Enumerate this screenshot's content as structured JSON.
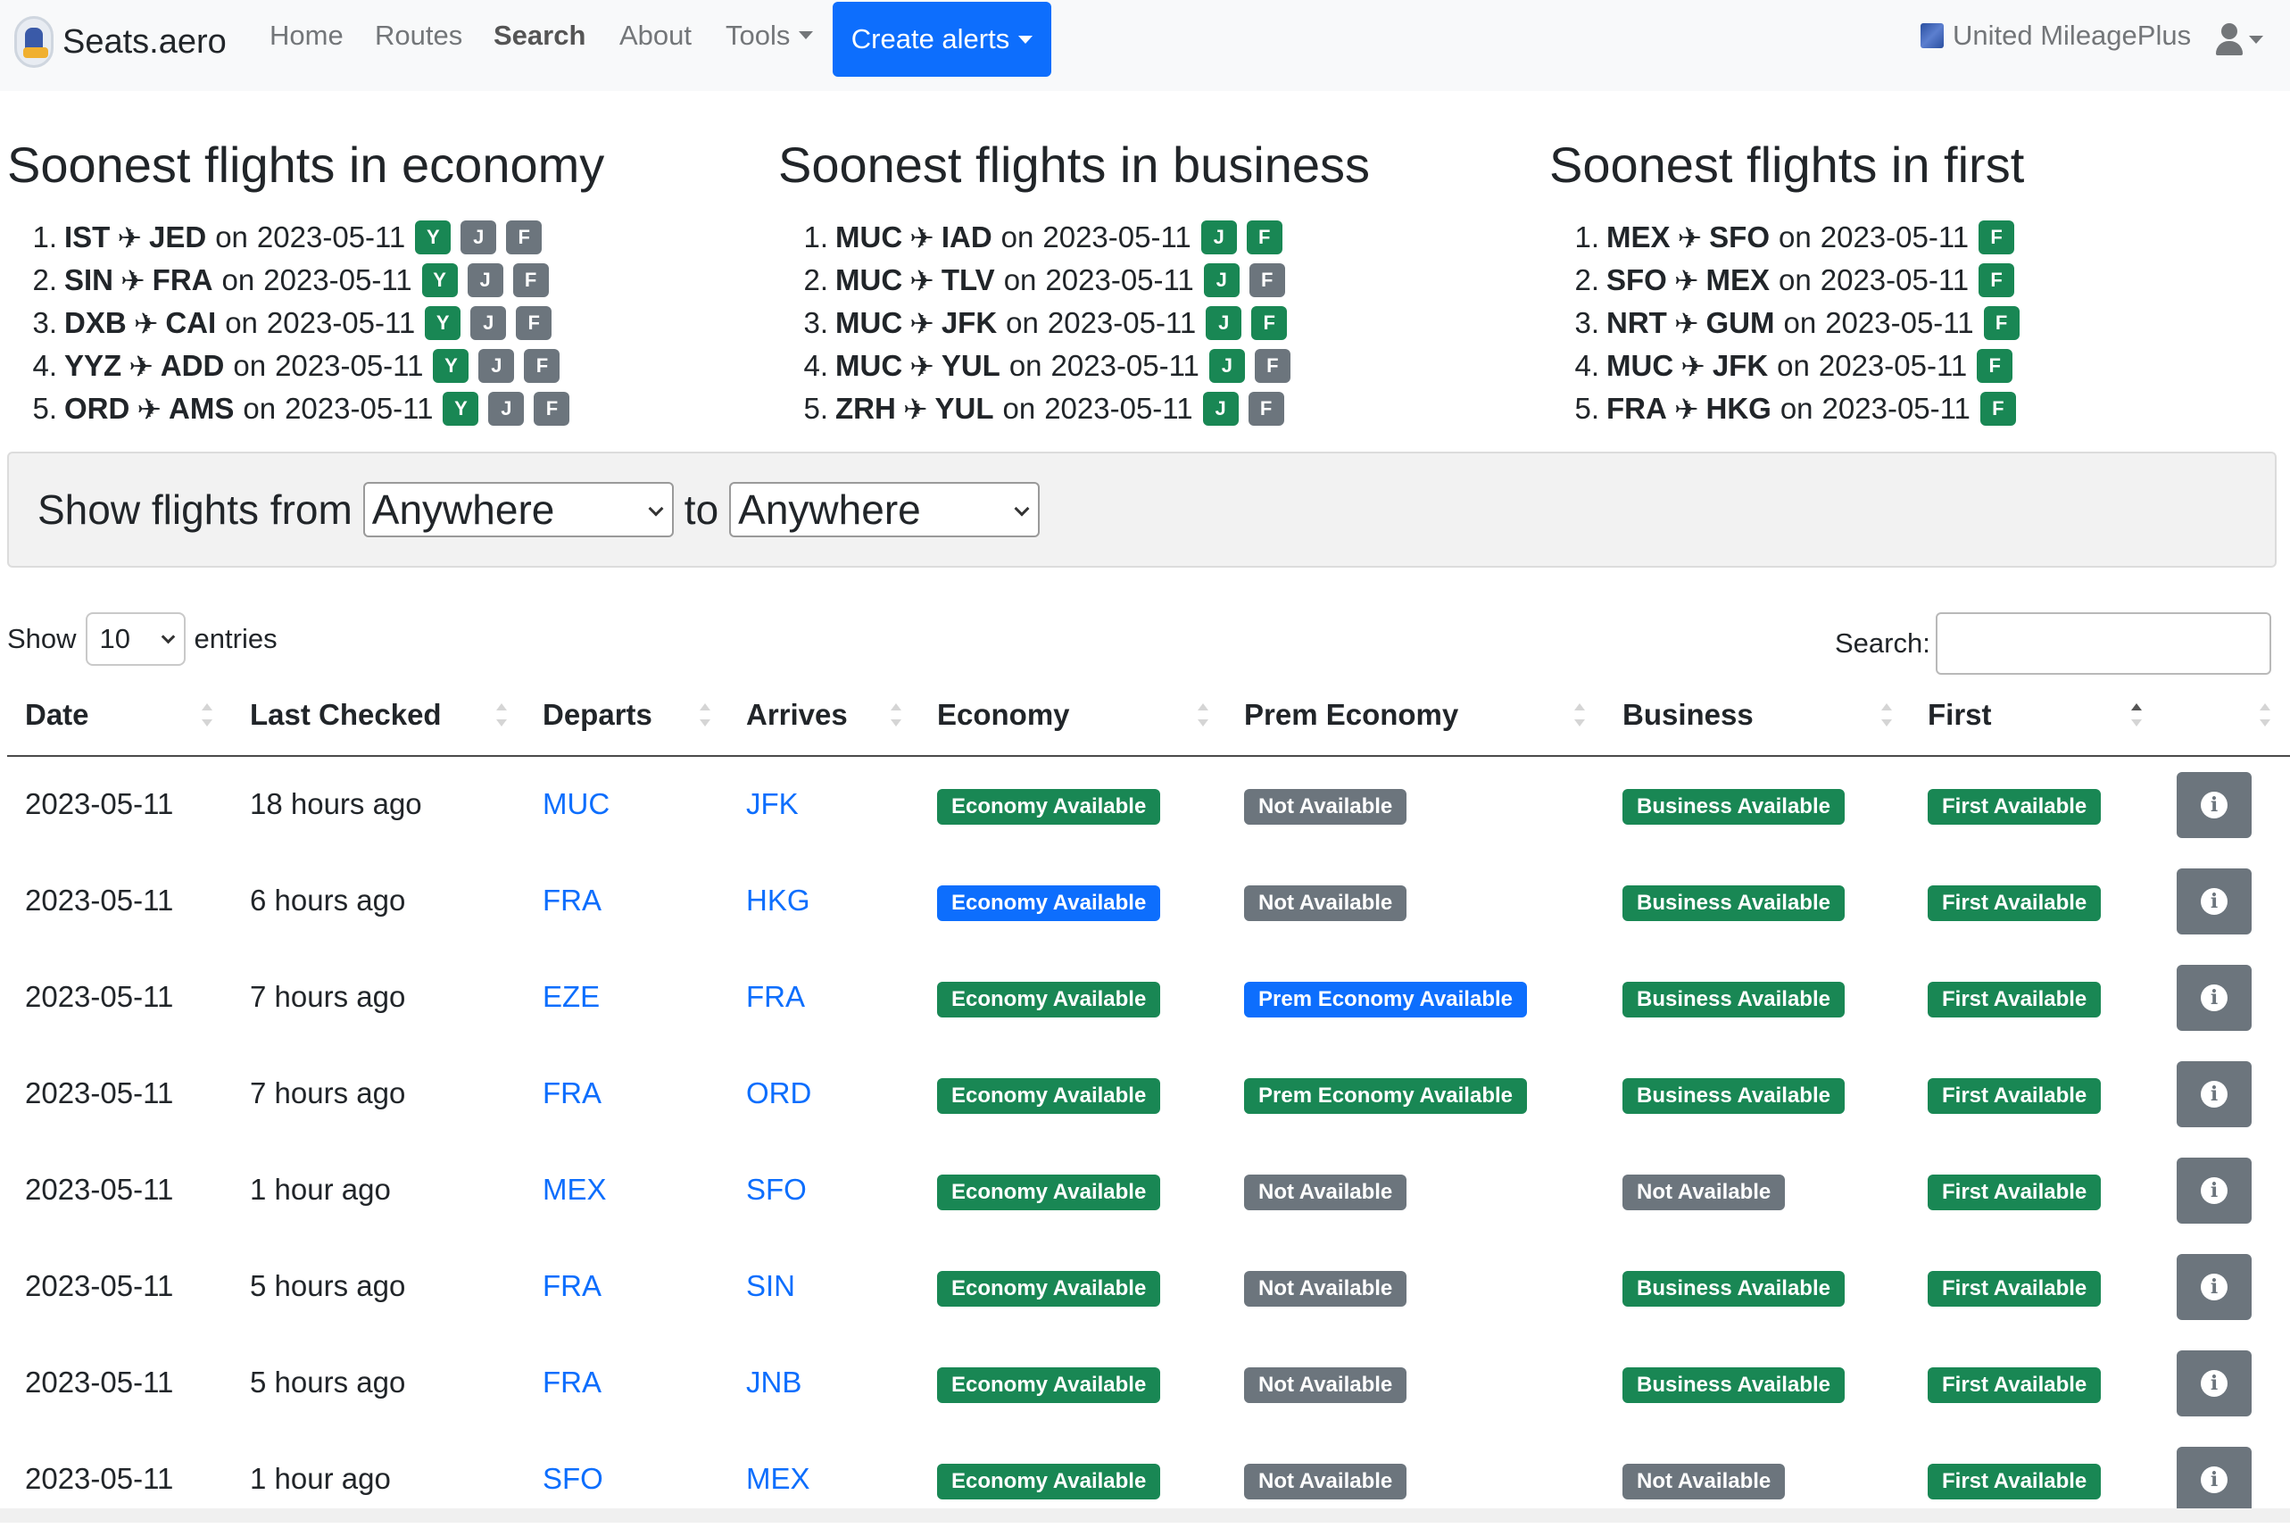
{
  "navbar": {
    "brand": "Seats.aero",
    "links": [
      "Home",
      "Routes",
      "Search",
      "About",
      "Tools"
    ],
    "create_alerts": "Create alerts",
    "program": "United MileagePlus"
  },
  "soonest": [
    {
      "title": "Soonest flights in economy",
      "items": [
        {
          "num": "1.",
          "from": "IST",
          "to": "JED",
          "on": "on",
          "date": "2023-05-11",
          "classes": [
            {
              "c": "Y",
              "s": "g"
            },
            {
              "c": "J",
              "s": "s"
            },
            {
              "c": "F",
              "s": "s"
            }
          ]
        },
        {
          "num": "2.",
          "from": "SIN",
          "to": "FRA",
          "on": "on",
          "date": "2023-05-11",
          "classes": [
            {
              "c": "Y",
              "s": "g"
            },
            {
              "c": "J",
              "s": "s"
            },
            {
              "c": "F",
              "s": "s"
            }
          ]
        },
        {
          "num": "3.",
          "from": "DXB",
          "to": "CAI",
          "on": "on",
          "date": "2023-05-11",
          "classes": [
            {
              "c": "Y",
              "s": "g"
            },
            {
              "c": "J",
              "s": "s"
            },
            {
              "c": "F",
              "s": "s"
            }
          ]
        },
        {
          "num": "4.",
          "from": "YYZ",
          "to": "ADD",
          "on": "on",
          "date": "2023-05-11",
          "classes": [
            {
              "c": "Y",
              "s": "g"
            },
            {
              "c": "J",
              "s": "s"
            },
            {
              "c": "F",
              "s": "s"
            }
          ]
        },
        {
          "num": "5.",
          "from": "ORD",
          "to": "AMS",
          "on": "on",
          "date": "2023-05-11",
          "classes": [
            {
              "c": "Y",
              "s": "g"
            },
            {
              "c": "J",
              "s": "s"
            },
            {
              "c": "F",
              "s": "s"
            }
          ]
        }
      ]
    },
    {
      "title": "Soonest flights in business",
      "items": [
        {
          "num": "1.",
          "from": "MUC",
          "to": "IAD",
          "on": "on",
          "date": "2023-05-11",
          "classes": [
            {
              "c": "J",
              "s": "g"
            },
            {
              "c": "F",
              "s": "g"
            }
          ]
        },
        {
          "num": "2.",
          "from": "MUC",
          "to": "TLV",
          "on": "on",
          "date": "2023-05-11",
          "classes": [
            {
              "c": "J",
              "s": "g"
            },
            {
              "c": "F",
              "s": "s"
            }
          ]
        },
        {
          "num": "3.",
          "from": "MUC",
          "to": "JFK",
          "on": "on",
          "date": "2023-05-11",
          "classes": [
            {
              "c": "J",
              "s": "g"
            },
            {
              "c": "F",
              "s": "g"
            }
          ]
        },
        {
          "num": "4.",
          "from": "MUC",
          "to": "YUL",
          "on": "on",
          "date": "2023-05-11",
          "classes": [
            {
              "c": "J",
              "s": "g"
            },
            {
              "c": "F",
              "s": "s"
            }
          ]
        },
        {
          "num": "5.",
          "from": "ZRH",
          "to": "YUL",
          "on": "on",
          "date": "2023-05-11",
          "classes": [
            {
              "c": "J",
              "s": "g"
            },
            {
              "c": "F",
              "s": "s"
            }
          ]
        }
      ]
    },
    {
      "title": "Soonest flights in first",
      "items": [
        {
          "num": "1.",
          "from": "MEX",
          "to": "SFO",
          "on": "on",
          "date": "2023-05-11",
          "classes": [
            {
              "c": "F",
              "s": "g"
            }
          ]
        },
        {
          "num": "2.",
          "from": "SFO",
          "to": "MEX",
          "on": "on",
          "date": "2023-05-11",
          "classes": [
            {
              "c": "F",
              "s": "g"
            }
          ]
        },
        {
          "num": "3.",
          "from": "NRT",
          "to": "GUM",
          "on": "on",
          "date": "2023-05-11",
          "classes": [
            {
              "c": "F",
              "s": "g"
            }
          ]
        },
        {
          "num": "4.",
          "from": "MUC",
          "to": "JFK",
          "on": "on",
          "date": "2023-05-11",
          "classes": [
            {
              "c": "F",
              "s": "g"
            }
          ]
        },
        {
          "num": "5.",
          "from": "FRA",
          "to": "HKG",
          "on": "on",
          "date": "2023-05-11",
          "classes": [
            {
              "c": "F",
              "s": "g"
            }
          ]
        }
      ]
    }
  ],
  "filter": {
    "label_from": "Show flights from",
    "from_value": "Anywhere",
    "label_to": "to",
    "to_value": "Anywhere"
  },
  "table_controls": {
    "show": "Show",
    "entries_value": "10",
    "entries": "entries",
    "search_label": "Search:"
  },
  "table": {
    "headers": [
      "Date",
      "Last Checked",
      "Departs",
      "Arrives",
      "Economy",
      "Prem Economy",
      "Business",
      "First"
    ],
    "rows": [
      {
        "date": "2023-05-11",
        "checked": "18 hours ago",
        "departs": "MUC",
        "arrives": "JFK",
        "economy": {
          "t": "Economy Available",
          "s": "green"
        },
        "prem": {
          "t": "Not Available",
          "s": "gray"
        },
        "business": {
          "t": "Business Available",
          "s": "green"
        },
        "first": {
          "t": "First Available",
          "s": "green"
        }
      },
      {
        "date": "2023-05-11",
        "checked": "6 hours ago",
        "departs": "FRA",
        "arrives": "HKG",
        "economy": {
          "t": "Economy Available",
          "s": "blue"
        },
        "prem": {
          "t": "Not Available",
          "s": "gray"
        },
        "business": {
          "t": "Business Available",
          "s": "green"
        },
        "first": {
          "t": "First Available",
          "s": "green"
        }
      },
      {
        "date": "2023-05-11",
        "checked": "7 hours ago",
        "departs": "EZE",
        "arrives": "FRA",
        "economy": {
          "t": "Economy Available",
          "s": "green"
        },
        "prem": {
          "t": "Prem Economy Available",
          "s": "blue"
        },
        "business": {
          "t": "Business Available",
          "s": "green"
        },
        "first": {
          "t": "First Available",
          "s": "green"
        }
      },
      {
        "date": "2023-05-11",
        "checked": "7 hours ago",
        "departs": "FRA",
        "arrives": "ORD",
        "economy": {
          "t": "Economy Available",
          "s": "green"
        },
        "prem": {
          "t": "Prem Economy Available",
          "s": "green"
        },
        "business": {
          "t": "Business Available",
          "s": "green"
        },
        "first": {
          "t": "First Available",
          "s": "green"
        }
      },
      {
        "date": "2023-05-11",
        "checked": "1 hour ago",
        "departs": "MEX",
        "arrives": "SFO",
        "economy": {
          "t": "Economy Available",
          "s": "green"
        },
        "prem": {
          "t": "Not Available",
          "s": "gray"
        },
        "business": {
          "t": "Not Available",
          "s": "gray"
        },
        "first": {
          "t": "First Available",
          "s": "green"
        }
      },
      {
        "date": "2023-05-11",
        "checked": "5 hours ago",
        "departs": "FRA",
        "arrives": "SIN",
        "economy": {
          "t": "Economy Available",
          "s": "green"
        },
        "prem": {
          "t": "Not Available",
          "s": "gray"
        },
        "business": {
          "t": "Business Available",
          "s": "green"
        },
        "first": {
          "t": "First Available",
          "s": "green"
        }
      },
      {
        "date": "2023-05-11",
        "checked": "5 hours ago",
        "departs": "FRA",
        "arrives": "JNB",
        "economy": {
          "t": "Economy Available",
          "s": "green"
        },
        "prem": {
          "t": "Not Available",
          "s": "gray"
        },
        "business": {
          "t": "Business Available",
          "s": "green"
        },
        "first": {
          "t": "First Available",
          "s": "green"
        }
      },
      {
        "date": "2023-05-11",
        "checked": "1 hour ago",
        "departs": "SFO",
        "arrives": "MEX",
        "economy": {
          "t": "Economy Available",
          "s": "green"
        },
        "prem": {
          "t": "Not Available",
          "s": "gray"
        },
        "business": {
          "t": "Not Available",
          "s": "gray"
        },
        "first": {
          "t": "First Available",
          "s": "green"
        }
      }
    ]
  },
  "icons": {
    "info": "info-icon",
    "plane": "plane-icon",
    "user": "user-icon"
  },
  "colors": {
    "primary": "#0d6efd",
    "success": "#198754",
    "secondary": "#6c757d"
  }
}
